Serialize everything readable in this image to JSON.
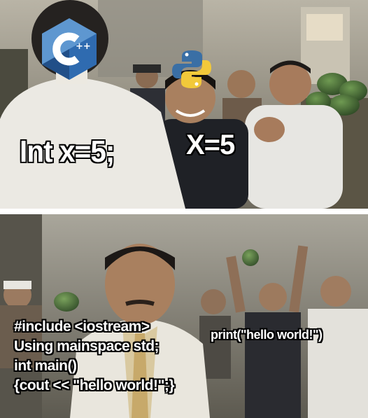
{
  "meme": {
    "top_panel": {
      "cpp_logo_icon": "c-plus-plus-logo-icon",
      "cpp_logo_text": "++",
      "python_logo_icon": "python-logo-icon",
      "left_caption": "Int x=5;",
      "right_caption": "X=5"
    },
    "bottom_panel": {
      "code_lines": [
        "#include <iostream>",
        "Using mainspace std;",
        "int main()",
        "{cout << \"hello world!\";}"
      ],
      "right_caption": "print(\"hello world!\")"
    }
  }
}
